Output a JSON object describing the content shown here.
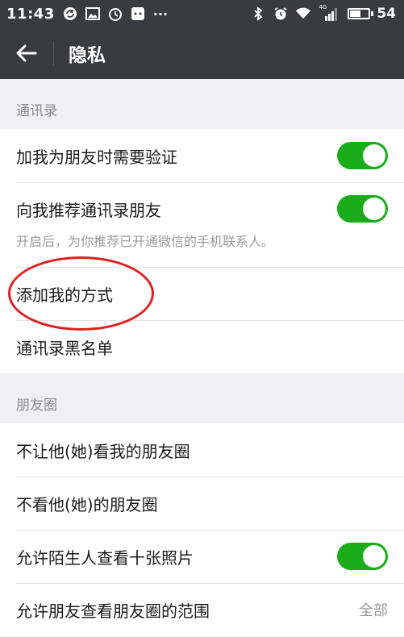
{
  "status_bar": {
    "time": "11:43",
    "left_icons": [
      "sync-icon",
      "image-icon",
      "alarm-clock-icon",
      "message-icon",
      "more-icon"
    ],
    "more_glyph": "···",
    "right_icons": [
      "bluetooth-icon",
      "alarm-icon",
      "wifi-icon",
      "signal-icon",
      "battery-icon"
    ],
    "network_label": "4G",
    "battery_level": "54",
    "battery_fraction": 0.54
  },
  "nav": {
    "title": "隐私",
    "back_icon": "back-arrow-icon"
  },
  "sections": {
    "contacts": {
      "header": "通讯录",
      "verify_label": "加我为朋友时需要验证",
      "verify_on": true,
      "recommend_label": "向我推荐通讯录朋友",
      "recommend_desc": "开启后，为你推荐已开通微信的手机联系人。",
      "recommend_on": true,
      "add_methods_label": "添加我的方式",
      "blacklist_label": "通讯录黑名单"
    },
    "moments": {
      "header": "朋友圈",
      "hide_my_label": "不让他(她)看我的朋友圈",
      "hide_their_label": "不看他(她)的朋友圈",
      "strangers_label": "允许陌生人查看十张照片",
      "strangers_on": true,
      "range_label": "允许朋友查看朋友圈的范围",
      "range_value": "全部"
    }
  },
  "colors": {
    "bar_bg": "#3a3b3f",
    "toggle_on": "#1aad19",
    "annotation": "#e02020"
  }
}
